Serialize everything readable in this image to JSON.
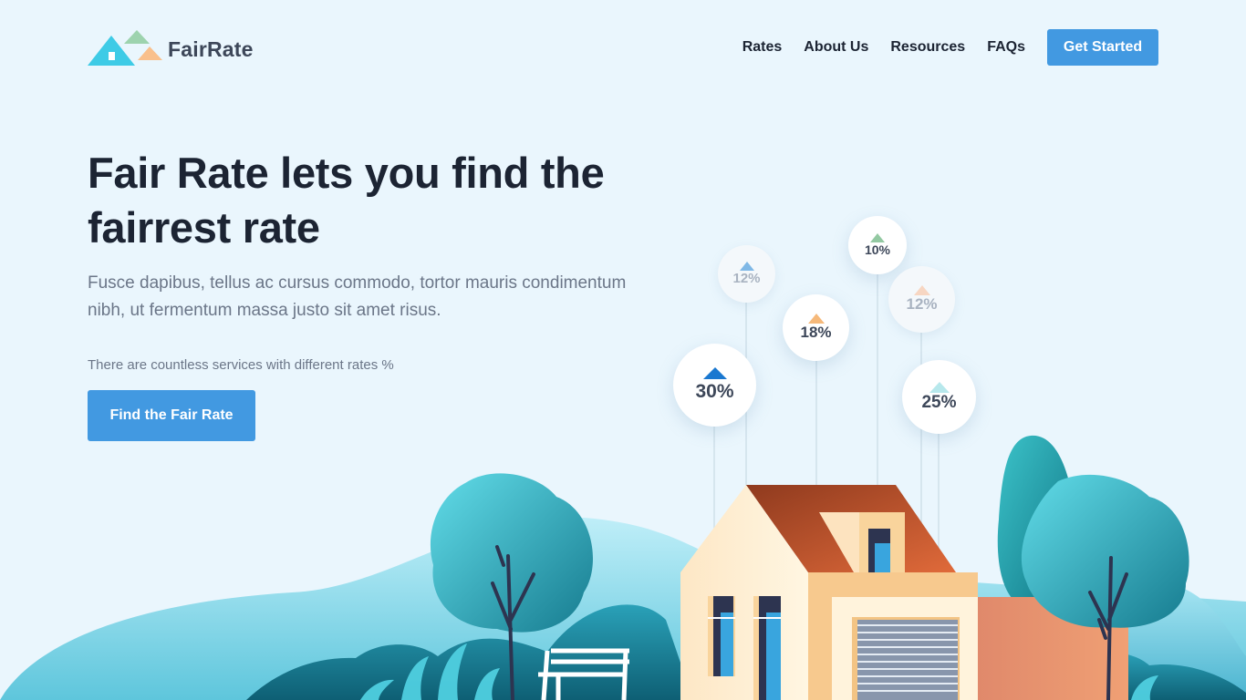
{
  "brand": {
    "name": "FairRate"
  },
  "nav": {
    "links": [
      "Rates",
      "About Us",
      "Resources",
      "FAQs"
    ],
    "cta_label": "Get Started"
  },
  "hero": {
    "title": "Fair Rate lets you find the fairrest rate",
    "subtitle": "Fusce dapibus, tellus ac cursus commodo, tortor mauris condimentum nibh, ut fermentum massa justo sit amet risus.",
    "note": "There are countless services with different rates %",
    "cta_label": "Find the Fair Rate"
  },
  "rate_bubbles": [
    {
      "value": "30%",
      "color": "#1a78d0"
    },
    {
      "value": "12%",
      "color": "#7fb8e6"
    },
    {
      "value": "18%",
      "color": "#f6b97a"
    },
    {
      "value": "10%",
      "color": "#93c9a2"
    },
    {
      "value": "12%",
      "color": "#f7d6c2"
    },
    {
      "value": "25%",
      "color": "#b7e8ec"
    }
  ],
  "colors": {
    "accent": "#4299e1",
    "background": "#eaf6fd",
    "heading": "#1c2433",
    "body_text": "#6b7688"
  },
  "icons": [
    "house-logo-icon"
  ]
}
